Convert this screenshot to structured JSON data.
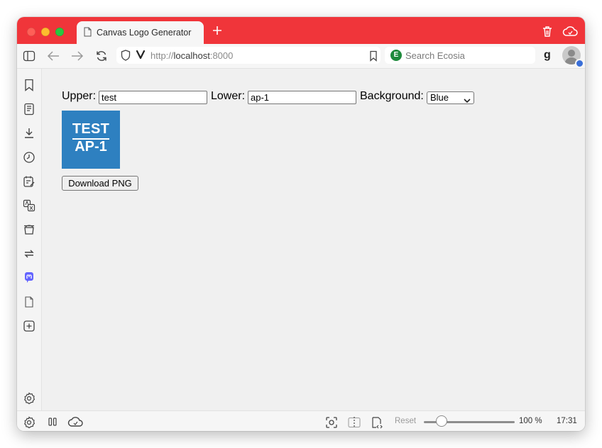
{
  "browser": {
    "tab_title": "Canvas Logo Generator",
    "url_scheme": "http://",
    "url_host": "localhost",
    "url_port": ":8000",
    "search_placeholder": "Search Ecosia",
    "profile_letter": "g",
    "accent_color": "#f0353a"
  },
  "form": {
    "upper_label": "Upper:",
    "upper_value": "test",
    "lower_label": "Lower:",
    "lower_value": "ap-1",
    "background_label": "Background:",
    "background_value": "Blue"
  },
  "logo": {
    "upper_text": "TEST",
    "lower_text": "AP-1",
    "background_color": "#2e80c0"
  },
  "download_button": "Download PNG",
  "status": {
    "reset_label": "Reset",
    "zoom_level": "100 %",
    "clock": "17:31",
    "zoom_fraction": 0.25
  }
}
